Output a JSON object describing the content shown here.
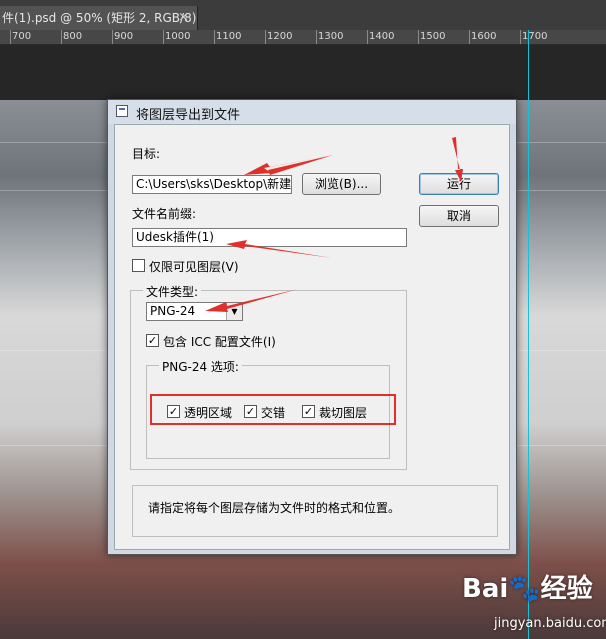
{
  "ps": {
    "tab_title": "件(1).psd @ 50% (矩形 2, RGB/8)",
    "tab_close": "×",
    "ruler_labels": [
      "700",
      "800",
      "900",
      "1000",
      "1100",
      "1200",
      "1300",
      "1400",
      "1500",
      "1600",
      "1700"
    ]
  },
  "dialog": {
    "title": "将图层导出到文件",
    "target_label": "目标:",
    "target_value": "C:\\Users\\sks\\Desktop\\新建文",
    "browse_button": "浏览(B)...",
    "run_button": "运行",
    "cancel_button": "取消",
    "prefix_label": "文件名前缀:",
    "prefix_value": "Udesk插件(1)",
    "visible_only_label": "仅限可见图层(V)",
    "visible_only_checked": false,
    "file_type_group": "文件类型:",
    "file_type_value": "PNG-24",
    "icc_label": "包含 ICC 配置文件(I)",
    "icc_checked": true,
    "png_options_group": "PNG-24 选项:",
    "transparency_label": "透明区域",
    "transparency_checked": true,
    "interlaced_label": "交错",
    "interlaced_checked": true,
    "trim_label": "裁切图层",
    "trim_checked": true,
    "description": "请指定将每个图层存储为文件时的格式和位置。"
  },
  "watermark": {
    "brand": "Bai🐾经验",
    "url": "jingyan.baidu.com"
  },
  "colors": {
    "annotation_red": "#e0302c",
    "guide_cyan": "#16c3d6"
  }
}
